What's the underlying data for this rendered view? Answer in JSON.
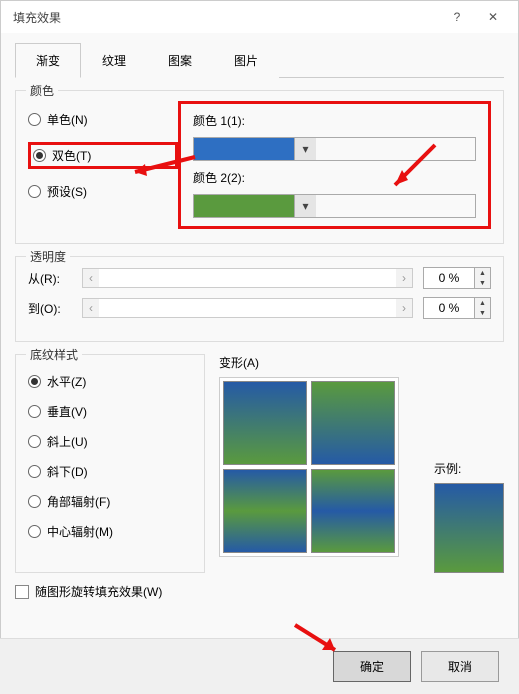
{
  "dialog_title": "填充效果",
  "tabs": [
    "渐变",
    "纹理",
    "图案",
    "图片"
  ],
  "active_tab": 0,
  "colors_section": {
    "legend": "颜色",
    "options": {
      "single": "单色(N)",
      "two": "双色(T)",
      "preset": "预设(S)"
    },
    "selected": "two",
    "color1_label": "颜色 1(1):",
    "color2_label": "颜色 2(2):",
    "color1": "#2e6fc2",
    "color2": "#5a9a3e"
  },
  "transparency_section": {
    "legend": "透明度",
    "from_label": "从(R):",
    "to_label": "到(O):",
    "from_value": "0 %",
    "to_value": "0 %"
  },
  "shading_section": {
    "legend": "底纹样式",
    "options": {
      "horizontal": "水平(Z)",
      "vertical": "垂直(V)",
      "diag_up": "斜上(U)",
      "diag_down": "斜下(D)",
      "corner": "角部辐射(F)",
      "center": "中心辐射(M)"
    },
    "selected": "horizontal"
  },
  "variant_label": "变形(A)",
  "sample_label": "示例:",
  "rotate_checkbox": "随图形旋转填充效果(W)",
  "buttons": {
    "ok": "确定",
    "cancel": "取消"
  }
}
